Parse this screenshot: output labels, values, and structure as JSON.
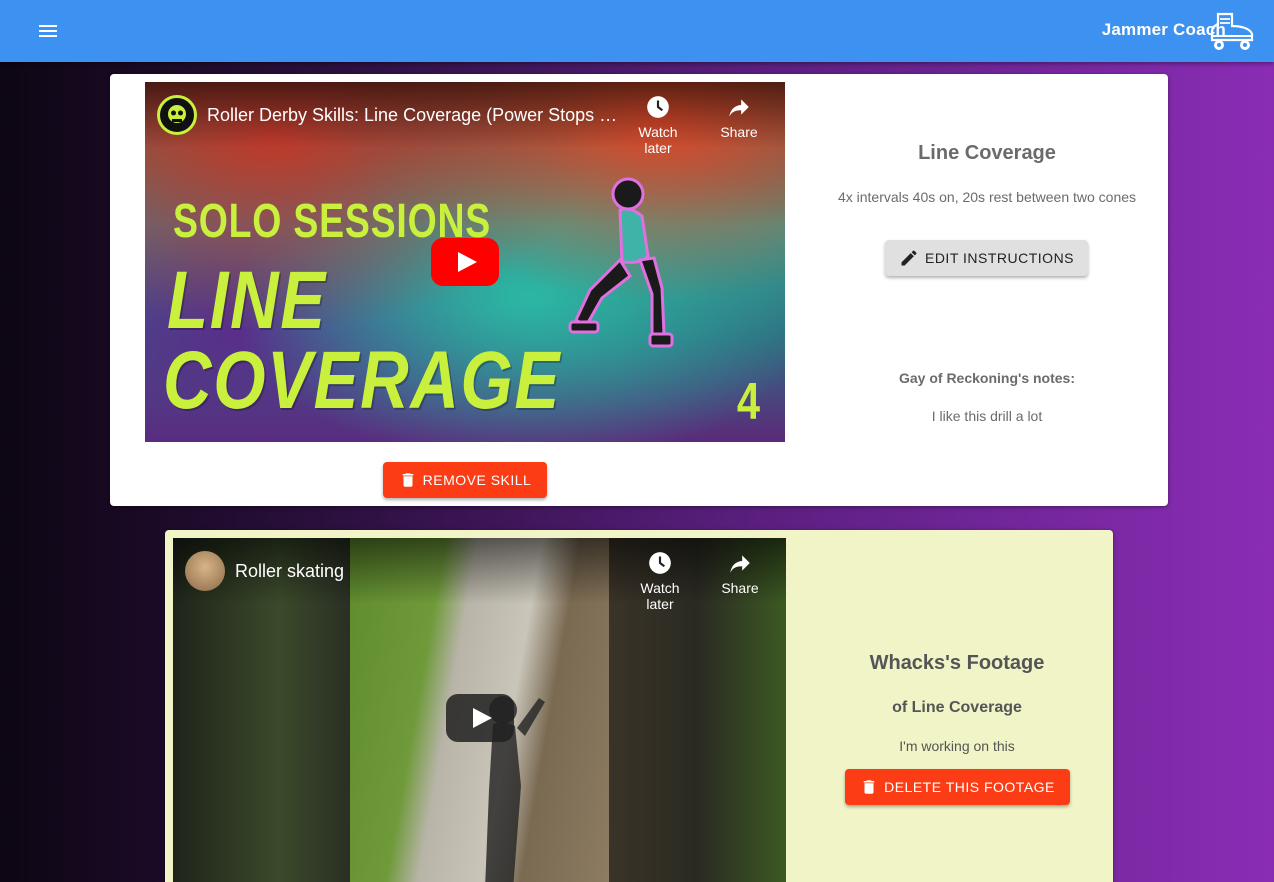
{
  "appbar": {
    "title": "Jammer Coach",
    "menu_icon": "menu-icon",
    "logo_icon": "roller-skate-icon",
    "color": "#3d91f0"
  },
  "skill_card": {
    "video": {
      "title": "Roller Derby Skills: Line Coverage (Power Stops &…",
      "watch_later": "Watch later",
      "share": "Share",
      "thumb_text_1": "SOLO SESSIONS",
      "thumb_text_2": "LINE",
      "thumb_text_3": "COVERAGE",
      "thumb_number": "4"
    },
    "remove_label": "REMOVE SKILL",
    "skill_title": "Line Coverage",
    "description": "4x intervals 40s on, 20s rest between two cones",
    "edit_label": "EDIT INSTRUCTIONS",
    "notes_label": "Gay of Reckoning's notes:",
    "notes_text": "I like this drill a lot"
  },
  "footage_card": {
    "video": {
      "title": "Roller skating",
      "watch_later": "Watch later",
      "share": "Share"
    },
    "title": "Whacks's Footage",
    "subtitle": "of Line Coverage",
    "note": "I'm working on this",
    "delete_label": "DELETE THIS FOOTAGE",
    "background": "#f0f4c6"
  },
  "colors": {
    "danger": "#fb3c14",
    "accent_green": "#c8f03c"
  }
}
